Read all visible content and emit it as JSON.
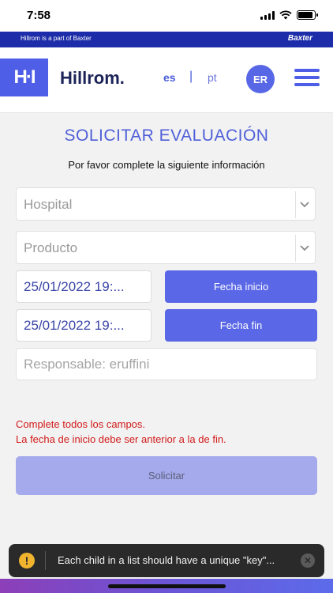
{
  "status_bar": {
    "time": "7:58"
  },
  "brand_strip": {
    "text": "Hillrom is a part of Baxter",
    "partner": "Baxter"
  },
  "header": {
    "logo_mark": "H·I",
    "logo_text": "Hillrom.",
    "languages": [
      "es",
      "|",
      "pt"
    ],
    "avatar_initials": "ER"
  },
  "form": {
    "title": "SOLICITAR EVALUACIÓN",
    "subtitle": "Por favor complete la siguiente información",
    "hospital_placeholder": "Hospital",
    "product_placeholder": "Producto",
    "start_date_value": "25/01/2022 19:...",
    "start_date_button": "Fecha inicio",
    "end_date_value": "25/01/2022 19:...",
    "end_date_button": "Fecha fin",
    "responsible_value": "Responsable: eruffini",
    "errors": [
      "Complete todos los campos.",
      "La fecha de inicio debe ser anterior a la de fin."
    ],
    "submit_label": "Solicitar"
  },
  "toast": {
    "message": "Each child in a list should have a unique \"key\"...",
    "icon": "!",
    "close": "✕"
  },
  "colors": {
    "accent": "#5a67e6",
    "brand_dark": "#1d2ca8",
    "error": "#d21a1a",
    "warning": "#f1b42f"
  }
}
